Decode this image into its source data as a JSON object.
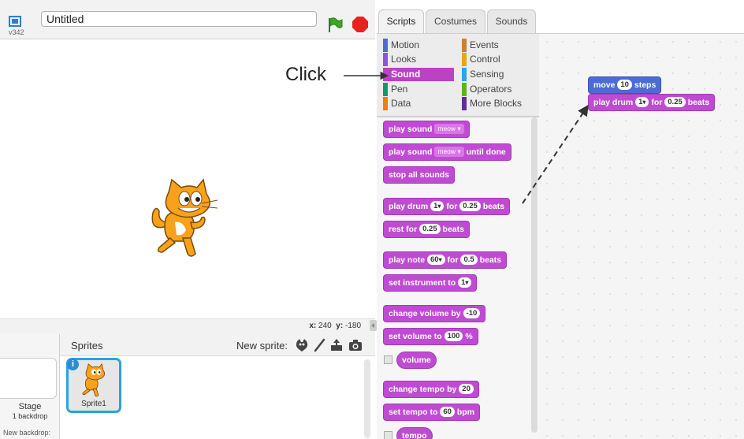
{
  "header": {
    "version": "v342",
    "project_title": "Untitled"
  },
  "annotation": {
    "click_label": "Click"
  },
  "coords": {
    "x_label": "x:",
    "x_value": "240",
    "y_label": "y:",
    "y_value": "-180"
  },
  "stage_pane": {
    "name": "Stage",
    "subtitle": "1 backdrop",
    "new_backdrop": "New backdrop:"
  },
  "sprites": {
    "title": "Sprites",
    "new_sprite_label": "New sprite:",
    "items": [
      {
        "name": "Sprite1"
      }
    ]
  },
  "tabs": [
    {
      "label": "Scripts",
      "active": true
    },
    {
      "label": "Costumes",
      "active": false
    },
    {
      "label": "Sounds",
      "active": false
    }
  ],
  "categories": [
    {
      "label": "Motion",
      "color": "#4a6cd4"
    },
    {
      "label": "Looks",
      "color": "#8a55d7"
    },
    {
      "label": "Sound",
      "color": "#bb42c3",
      "active": true
    },
    {
      "label": "Pen",
      "color": "#0e9a6c"
    },
    {
      "label": "Data",
      "color": "#ee7d16"
    },
    {
      "label": "Events",
      "color": "#c88330"
    },
    {
      "label": "Control",
      "color": "#e1a91a"
    },
    {
      "label": "Sensing",
      "color": "#2ca5e2"
    },
    {
      "label": "Operators",
      "color": "#5cb712"
    },
    {
      "label": "More Blocks",
      "color": "#632d99"
    }
  ],
  "blocks": {
    "play_sound": {
      "label": "play sound",
      "value": "meow"
    },
    "play_sound_until": {
      "label": "play sound",
      "value": "meow",
      "suffix": "until done"
    },
    "stop_all": {
      "label": "stop all sounds"
    },
    "play_drum": {
      "label": "play drum",
      "drum": "1",
      "for": "for",
      "beats_val": "0.25",
      "beats": "beats"
    },
    "rest": {
      "label": "rest for",
      "value": "0.25",
      "suffix": "beats"
    },
    "play_note": {
      "label": "play note",
      "note": "60",
      "for": "for",
      "beats_val": "0.5",
      "beats": "beats"
    },
    "set_instrument": {
      "label": "set instrument to",
      "value": "1"
    },
    "change_volume": {
      "label": "change volume by",
      "value": "-10"
    },
    "set_volume": {
      "label": "set volume to",
      "value": "100",
      "suffix": "%"
    },
    "volume": {
      "label": "volume"
    },
    "change_tempo": {
      "label": "change tempo by",
      "value": "20"
    },
    "set_tempo": {
      "label": "set tempo to",
      "value": "60",
      "suffix": "bpm"
    },
    "tempo": {
      "label": "tempo"
    }
  },
  "script": {
    "move": {
      "label": "move",
      "value": "10",
      "suffix": "steps"
    },
    "drum": {
      "label": "play drum",
      "drum": "1",
      "for": "for",
      "beats_val": "0.25",
      "beats": "beats"
    }
  }
}
